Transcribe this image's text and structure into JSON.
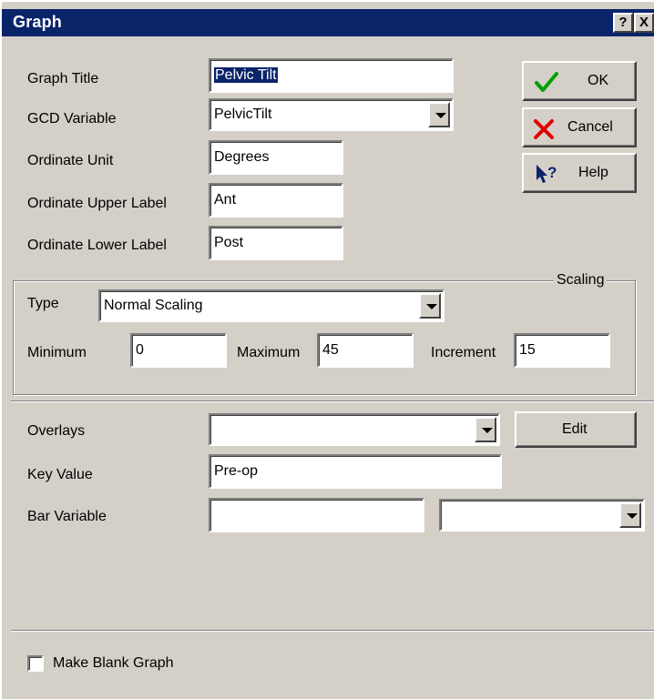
{
  "window": {
    "title": "Graph",
    "help_glyph": "?",
    "close_glyph": "X"
  },
  "form": {
    "graph_title": {
      "label": "Graph Title",
      "value": "Pelvic Tilt"
    },
    "gcd_variable": {
      "label": "GCD Variable",
      "value": "PelvicTilt"
    },
    "ordinate_unit": {
      "label": "Ordinate Unit",
      "value": "Degrees"
    },
    "ordinate_upper_label": {
      "label": "Ordinate Upper Label",
      "value": "Ant"
    },
    "ordinate_lower_label": {
      "label": "Ordinate Lower Label",
      "value": "Post"
    }
  },
  "buttons": {
    "ok": {
      "label": "OK",
      "icon": "checkmark-icon",
      "color": "#00a000"
    },
    "cancel": {
      "label": "Cancel",
      "icon": "x-icon",
      "color": "#e00000"
    },
    "help": {
      "label": "Help",
      "icon": "help-pointer-icon",
      "color": "#0a246a"
    },
    "edit": {
      "label": "Edit"
    }
  },
  "scaling": {
    "caption": "Scaling",
    "type": {
      "label": "Type",
      "value": "Normal Scaling"
    },
    "minimum": {
      "label": "Minimum",
      "value": "0"
    },
    "maximum": {
      "label": "Maximum",
      "value": "45"
    },
    "increment": {
      "label": "Increment",
      "value": "15"
    }
  },
  "overlays": {
    "label": "Overlays",
    "value": ""
  },
  "key_value": {
    "label": "Key Value",
    "value": "Pre-op"
  },
  "bar_variable": {
    "label": "Bar Variable",
    "value": "",
    "select_value": ""
  },
  "make_blank_graph": {
    "label": "Make Blank Graph",
    "checked": false
  }
}
